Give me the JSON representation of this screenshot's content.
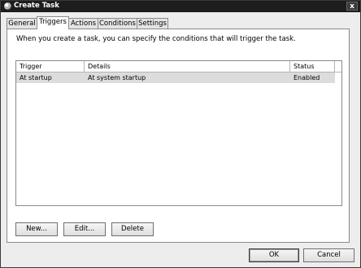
{
  "window": {
    "title": "Create Task",
    "close_glyph": "x"
  },
  "tabs": [
    {
      "label": "General",
      "active": false
    },
    {
      "label": "Triggers",
      "active": true
    },
    {
      "label": "Actions",
      "active": false
    },
    {
      "label": "Conditions",
      "active": false
    },
    {
      "label": "Settings",
      "active": false
    }
  ],
  "triggers_panel": {
    "description": "When you create a task, you can specify the conditions that will trigger the task.",
    "columns": [
      "Trigger",
      "Details",
      "Status"
    ],
    "rows": [
      {
        "trigger": "At startup",
        "details": "At system startup",
        "status": "Enabled",
        "selected": true
      }
    ],
    "buttons": {
      "new": "New...",
      "edit": "Edit...",
      "delete": "Delete"
    }
  },
  "dialog_buttons": {
    "ok": "OK",
    "cancel": "Cancel"
  },
  "icons": {
    "app": "task-scheduler-icon",
    "close": "close-icon"
  }
}
